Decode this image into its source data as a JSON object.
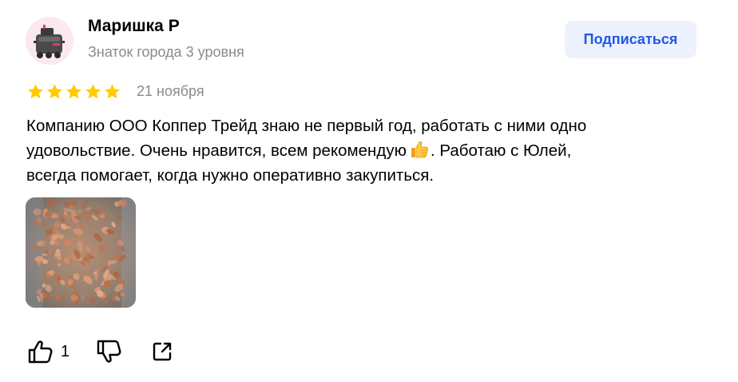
{
  "author": {
    "name": "Маришка Р",
    "level": "Знаток города 3 уровня"
  },
  "subscribe_button": {
    "label": "Подписаться"
  },
  "review": {
    "rating": 5,
    "max_rating": 5,
    "date": "21 ноября",
    "text_line1": "Компанию ООО Коппер Трейд знаю не первый год, работать с ними одно",
    "text_line2_before_emoji": "удовольствие. Очень нравится, всем рекомендую",
    "text_line2_after_emoji": ". Работаю с Юлей,",
    "text_line3": "всегда помогает, когда нужно оперативно закупиться."
  },
  "actions": {
    "like_count": "1"
  },
  "colors": {
    "star": "#fc0",
    "subscribe_bg": "#ecf1fd",
    "subscribe_text": "#1f5ae5",
    "secondary_text": "#8b8b8b",
    "avatar_bg": "#fbe8f1"
  },
  "icons": {
    "avatar": "robot-courier-icon",
    "star": "star-icon",
    "emoji": "thumbs-up-emoji",
    "like": "thumbs-up-icon",
    "dislike": "thumbs-down-icon",
    "share": "share-icon"
  }
}
